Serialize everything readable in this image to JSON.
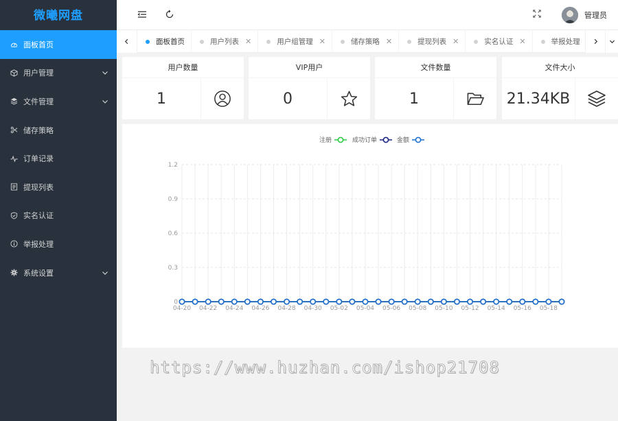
{
  "app": {
    "name": "微曦网盘"
  },
  "sidebar": {
    "items": [
      {
        "label": "面板首页",
        "icon": "dashboard-icon",
        "active": true
      },
      {
        "label": "用户管理",
        "icon": "cube-icon",
        "expandable": true
      },
      {
        "label": "文件管理",
        "icon": "layers-icon",
        "expandable": true
      },
      {
        "label": "储存策略",
        "icon": "scissors-icon"
      },
      {
        "label": "订单记录",
        "icon": "pulse-icon"
      },
      {
        "label": "提现列表",
        "icon": "list-icon"
      },
      {
        "label": "实名认证",
        "icon": "shield-check-icon"
      },
      {
        "label": "举报处理",
        "icon": "info-circle-icon"
      },
      {
        "label": "系统设置",
        "icon": "gear-icon",
        "expandable": true
      }
    ]
  },
  "header": {
    "user": {
      "name": "管理员"
    }
  },
  "tabs": [
    {
      "label": "面板首页",
      "active": true,
      "closable": false
    },
    {
      "label": "用户列表",
      "closable": true
    },
    {
      "label": "用户组管理",
      "closable": true
    },
    {
      "label": "储存策略",
      "closable": true
    },
    {
      "label": "提现列表",
      "closable": true
    },
    {
      "label": "实名认证",
      "closable": true
    },
    {
      "label": "举报处理",
      "closable": true
    }
  ],
  "stats": [
    {
      "title": "用户数量",
      "value": "1",
      "icon": "user-circle-icon"
    },
    {
      "title": "VIP用户",
      "value": "0",
      "icon": "star-icon"
    },
    {
      "title": "文件数量",
      "value": "1",
      "icon": "folder-open-icon"
    },
    {
      "title": "文件大小",
      "value": "21.34KB",
      "icon": "layers-icon"
    }
  ],
  "chart_data": {
    "type": "line",
    "x": [
      "04-20",
      "04-21",
      "04-22",
      "04-23",
      "04-24",
      "04-25",
      "04-26",
      "04-27",
      "04-28",
      "04-29",
      "04-30",
      "05-01",
      "05-02",
      "05-03",
      "05-04",
      "05-05",
      "05-06",
      "05-07",
      "05-08",
      "05-09",
      "05-10",
      "05-11",
      "05-12",
      "05-13",
      "05-14",
      "05-15",
      "05-16",
      "05-17",
      "05-18",
      "05-19"
    ],
    "x_tick_labels": [
      "04-20",
      "04-22",
      "04-24",
      "04-26",
      "04-28",
      "04-30",
      "05-02",
      "05-04",
      "05-06",
      "05-08",
      "05-10",
      "05-12",
      "05-14",
      "05-16",
      "05-18"
    ],
    "series": [
      {
        "name": "注册",
        "color": "#2ecc40",
        "values": [
          0,
          0,
          0,
          0,
          0,
          0,
          0,
          0,
          0,
          0,
          0,
          0,
          0,
          0,
          0,
          0,
          0,
          0,
          0,
          0,
          0,
          0,
          0,
          0,
          0,
          0,
          0,
          0,
          0,
          0
        ]
      },
      {
        "name": "成功订单",
        "color": "#1a237e",
        "values": [
          0,
          0,
          0,
          0,
          0,
          0,
          0,
          0,
          0,
          0,
          0,
          0,
          0,
          0,
          0,
          0,
          0,
          0,
          0,
          0,
          0,
          0,
          0,
          0,
          0,
          0,
          0,
          0,
          0,
          0
        ]
      },
      {
        "name": "金额",
        "color": "#1e6fd0",
        "values": [
          0,
          0,
          0,
          0,
          0,
          0,
          0,
          0,
          0,
          0,
          0,
          0,
          0,
          0,
          0,
          0,
          0,
          0,
          0,
          0,
          0,
          0,
          0,
          0,
          0,
          0,
          0,
          0,
          0,
          0
        ]
      }
    ],
    "ylim": [
      0,
      1.2
    ],
    "y_ticks": [
      "0",
      "0.3",
      "0.6",
      "0.9",
      "1.2"
    ],
    "grid": true,
    "legend": "top-center"
  },
  "watermark": "https://www.huzhan.com/ishop21708"
}
